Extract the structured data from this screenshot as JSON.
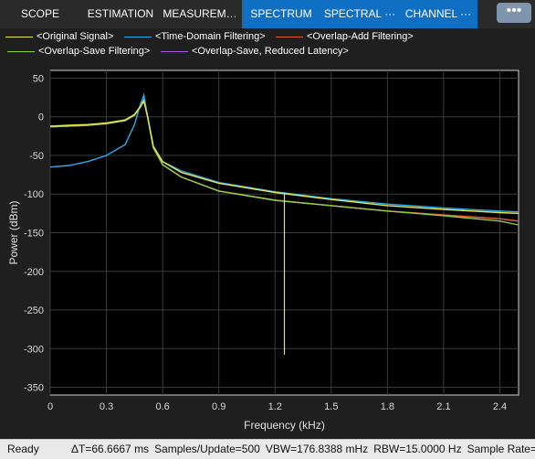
{
  "toolstrip": {
    "tabs": [
      {
        "label": "SCOPE",
        "active": false
      },
      {
        "label": "ESTIMATION",
        "active": false
      },
      {
        "label": "MEASUREM…",
        "active": false
      },
      {
        "label": "SPECTRUM",
        "active": true
      },
      {
        "label": "SPECTRAL ···",
        "active": true
      },
      {
        "label": "CHANNEL ···",
        "active": true
      }
    ],
    "more_label": "•••",
    "more_icon": "more-options-icon"
  },
  "colors": {
    "original": "#e6e64c",
    "time_domain": "#2ea9e6",
    "overlap_add": "#e05c2a",
    "overlap_save": "#8ecf3c",
    "reduced_latency": "#a35ee0",
    "axes_bg": "#000000",
    "figure_bg": "#1f1f1f",
    "active_tab": "#0f6fc2"
  },
  "status": {
    "ready": "Ready",
    "delta_t": "ΔT=66.6667 ms",
    "samples_update": "Samples/Update=500",
    "vbw": "VBW=176.8388 mHz",
    "rbw": "RBW=15.0000 Hz",
    "sample_rate": "Sample Rate="
  },
  "chart_data": {
    "type": "line",
    "title": "",
    "xlabel": "Frequency (kHz)",
    "ylabel": "Power (dBm)",
    "xlim": [
      0,
      2.5
    ],
    "ylim": [
      -360,
      60
    ],
    "xticks": [
      "0",
      "0.3",
      "0.6",
      "0.9",
      "1.2",
      "1.5",
      "1.8",
      "2.1",
      "2.4"
    ],
    "yticks": [
      "50",
      "0",
      "-50",
      "-100",
      "-150",
      "-200",
      "-250",
      "-300",
      "-350"
    ],
    "grid": true,
    "legend_position": "top",
    "series": [
      {
        "name": "<Original Signal>",
        "key": "original",
        "x": [
          0,
          0.1,
          0.2,
          0.3,
          0.4,
          0.45,
          0.48,
          0.5,
          0.52,
          0.55,
          0.6,
          0.7,
          0.9,
          1.2,
          1.5,
          1.8,
          2.1,
          2.4,
          2.5
        ],
        "y": [
          -12,
          -11,
          -10,
          -8,
          -4,
          3,
          13,
          20,
          0,
          -38,
          -58,
          -72,
          -86,
          -98,
          -107,
          -115,
          -120,
          -124,
          -125
        ]
      },
      {
        "name": "<Time-Domain Filtering>",
        "key": "time_domain",
        "x": [
          0,
          0.1,
          0.2,
          0.3,
          0.4,
          0.45,
          0.48,
          0.5,
          0.52,
          0.55,
          0.6,
          0.7,
          0.9,
          1.2,
          1.5,
          1.8,
          2.1,
          2.4,
          2.5
        ],
        "y": [
          -65,
          -63,
          -58,
          -50,
          -36,
          -10,
          15,
          28,
          0,
          -38,
          -58,
          -70,
          -85,
          -97,
          -106,
          -113,
          -118,
          -122,
          -123
        ]
      },
      {
        "name": "<Overlap-Add Filtering>",
        "key": "overlap_add",
        "x": [
          0,
          0.1,
          0.2,
          0.3,
          0.4,
          0.45,
          0.48,
          0.5,
          0.52,
          0.55,
          0.6,
          0.7,
          0.9,
          1.2,
          1.5,
          1.8,
          2.1,
          2.4,
          2.5
        ],
        "y": [
          -13,
          -12,
          -11,
          -9,
          -5,
          2,
          12,
          22,
          0,
          -40,
          -62,
          -78,
          -96,
          -108,
          -115,
          -122,
          -127,
          -132,
          -135
        ]
      },
      {
        "name": "<Overlap-Save Filtering>",
        "key": "overlap_save",
        "x": [
          0,
          0.1,
          0.2,
          0.3,
          0.4,
          0.45,
          0.48,
          0.5,
          0.52,
          0.55,
          0.6,
          0.7,
          0.9,
          1.2,
          1.5,
          1.8,
          2.1,
          2.4,
          2.5
        ],
        "y": [
          -13,
          -12,
          -11,
          -9,
          -5,
          2,
          12,
          22,
          0,
          -40,
          -62,
          -78,
          -96,
          -108,
          -115,
          -122,
          -128,
          -135,
          -140
        ]
      },
      {
        "name": "<Overlap-Save,  Reduced Latency>",
        "key": "reduced_latency",
        "x": [
          0,
          0.1,
          0.2,
          0.3,
          0.4,
          0.45,
          0.48,
          0.5,
          0.52,
          0.55,
          0.6,
          0.7,
          0.9,
          1.2,
          1.5,
          1.8,
          2.1,
          2.4,
          2.5
        ],
        "y": [
          -13,
          -12,
          -11,
          -9,
          -5,
          2,
          12,
          22,
          0,
          -40,
          -62,
          -78,
          -96,
          -108,
          -115,
          -122,
          -127,
          -132,
          -135
        ]
      }
    ],
    "annotations": [
      {
        "series": "original",
        "x": 1.25,
        "y": -308,
        "note": "deep notch"
      }
    ]
  }
}
